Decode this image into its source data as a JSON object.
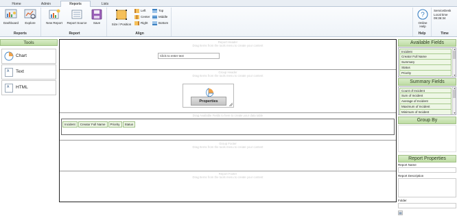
{
  "tabs": [
    {
      "label": "Home"
    },
    {
      "label": "Admin"
    },
    {
      "label": "Reports"
    },
    {
      "label": "Lists"
    }
  ],
  "ribbon": {
    "reports_group": {
      "label": "Reports",
      "dashboard": "Dashboard",
      "explore": "Explore"
    },
    "report_group": {
      "label": "Report",
      "new_report": "New Report",
      "report_source": "Report Source",
      "save": "Save"
    },
    "align_group": {
      "label": "Align",
      "size_position": "Size / Position",
      "left": "Left",
      "center": "Center",
      "right": "Right",
      "top": "Top",
      "middle": "Middle",
      "bottom": "Bottom"
    },
    "help_group": {
      "label": "Help",
      "online_help": "Online Help"
    },
    "time_group": {
      "label": "Time",
      "service": "ServiceDesk",
      "local_time_label": "Local time",
      "clock": "09:36:34"
    }
  },
  "tools": {
    "title": "Tools",
    "items": [
      {
        "label": "Chart"
      },
      {
        "label": "Text"
      },
      {
        "label": "HTML"
      }
    ]
  },
  "canvas": {
    "report_header": {
      "title": "Report Header",
      "hint": "Drag Items from the tools menu to create your content",
      "textbox": "Click to enter text"
    },
    "group_header": {
      "title": "Group Header",
      "hint": "Drag Items from the tools menu to create your content",
      "properties": "Properties"
    },
    "data": {
      "hint": "Drag Available Fields to here to create your data table",
      "columns": [
        "Incident",
        "Creator Full Name",
        "Priority",
        "Status"
      ]
    },
    "group_footer": {
      "title": "Group Footer",
      "hint": "Drag Items from the tools menu to create your content"
    },
    "report_footer": {
      "title": "Report Footer",
      "hint": "Drag Items from the tools menu to create your content"
    }
  },
  "right_panel": {
    "available_fields": {
      "title": "Available Fields",
      "items": [
        "Incident",
        "Creator Full Name",
        "Summary",
        "Status",
        "Priority"
      ]
    },
    "summary_fields": {
      "title": "Summary Fields",
      "items": [
        "Count of Incident",
        "Sum of Incident",
        "Average of Incident",
        "Maximum of Incident",
        "Minimum of Incident"
      ]
    },
    "group_by": {
      "title": "Group By"
    },
    "report_properties": {
      "title": "Report Properties",
      "report_name": "Report Name",
      "report_description": "Report Description",
      "folder": "Folder"
    }
  },
  "colors": {
    "panel_header": "#bddca3",
    "field_item": "#eef7e5",
    "accent": "#3a7fc1"
  }
}
